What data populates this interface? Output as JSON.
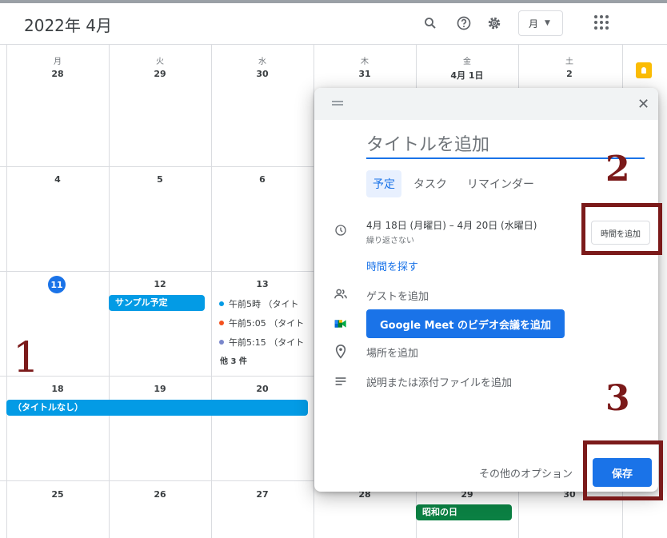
{
  "header": {
    "title": "2022年 4月",
    "view_label": "月"
  },
  "days_of_week": [
    "月",
    "火",
    "水",
    "木",
    "金",
    "土"
  ],
  "weeks": [
    [
      "28",
      "29",
      "30",
      "31",
      "4月 1日",
      "2"
    ],
    [
      "4",
      "5",
      "6",
      "",
      "",
      ""
    ],
    [
      "11",
      "12",
      "13",
      "",
      "",
      ""
    ],
    [
      "18",
      "19",
      "20",
      "",
      "",
      ""
    ],
    [
      "25",
      "26",
      "27",
      "28",
      "29",
      "30"
    ]
  ],
  "events": {
    "sample": "サンプル予定",
    "items": [
      {
        "label": "午前5時 （タイト",
        "color": "#039be5"
      },
      {
        "label": "午前5:05 （タイト",
        "color": "#f4511e"
      },
      {
        "label": "午前5:15 （タイト",
        "color": "#7986cb"
      }
    ],
    "more": "他 3 件",
    "notitle": "（タイトルなし）",
    "holiday": "昭和の日"
  },
  "dialog": {
    "title_placeholder": "タイトルを追加",
    "tabs": [
      "予定",
      "タスク",
      "リマインダー"
    ],
    "date_range": "4月 18日 (月曜日)  –  4月 20日 (水曜日)",
    "repeat": "繰り返さない",
    "add_time": "時間を追加",
    "find_time": "時間を探す",
    "guests": "ゲストを追加",
    "meet": "Google Meet のビデオ会議を追加",
    "location": "場所を追加",
    "description": "説明または添付ファイルを追加",
    "more_options": "その他のオプション",
    "save": "保存"
  },
  "annotations": [
    "1",
    "2",
    "3"
  ],
  "colors": {
    "primary": "#1a73e8",
    "event_chip": "#039be5",
    "holiday": "#0b8043",
    "annotation": "#7b1a1a"
  }
}
